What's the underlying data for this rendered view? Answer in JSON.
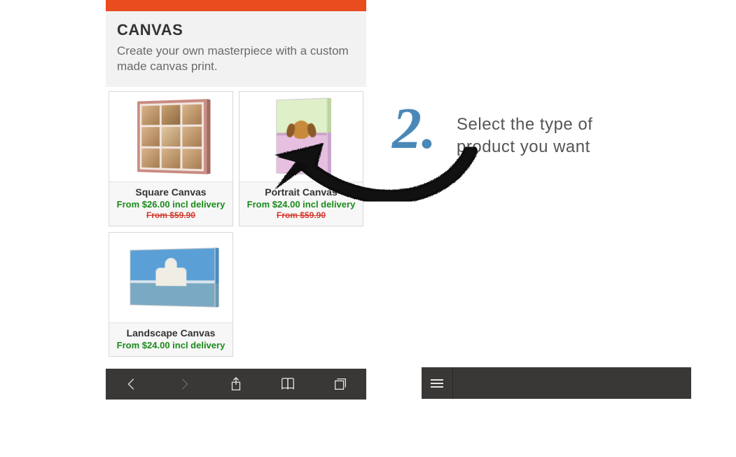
{
  "header": {
    "title": "CANVAS",
    "description": "Create your own masterpiece with a custom made canvas print."
  },
  "products": [
    {
      "name": "Square Canvas",
      "price": "From $26.00 incl delivery",
      "old_price": "From $59.90"
    },
    {
      "name": "Portrait Canvas",
      "price": "From $24.00 incl delivery",
      "old_price": "From $59.90"
    },
    {
      "name": "Landscape Canvas",
      "price": "From $24.00 incl delivery",
      "old_price": ""
    }
  ],
  "step": {
    "number": "2.",
    "text_line1": "Select the type of",
    "text_line2": "product you want"
  },
  "icons": {
    "back": "back-icon",
    "forward": "forward-icon",
    "share": "share-icon",
    "bookmarks": "bookmarks-icon",
    "tabs": "tabs-icon",
    "menu": "menu-icon"
  }
}
